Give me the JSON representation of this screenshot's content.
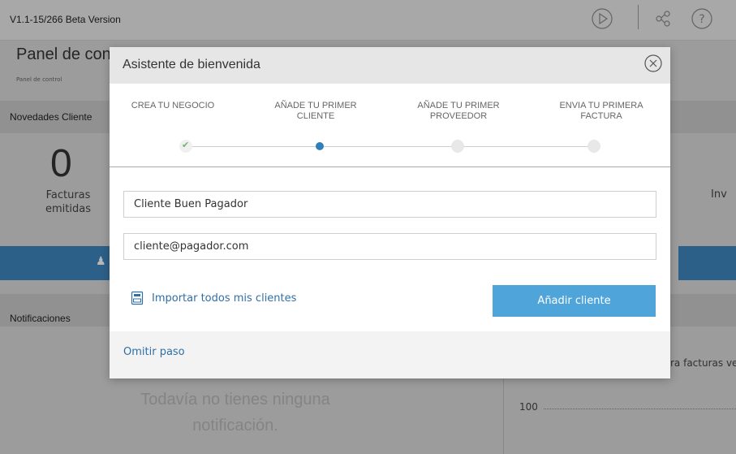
{
  "app": {
    "version": "V1.1-15/266 Beta Version",
    "panel_title": "Panel de control",
    "panel_breadcrumb": "Panel de control"
  },
  "background": {
    "news_label": "Novedades Cliente",
    "stat_value": "0",
    "stat_label": "Facturas emitidas",
    "stat_right_label": "Inv",
    "notifications_label": "Notificaciones",
    "empty_notifications": "Todavía no tienes ninguna notificación.",
    "chart_caption": "ra facturas ve",
    "chart_y_tick": "100"
  },
  "modal": {
    "title": "Asistente de bienvenida",
    "steps": [
      {
        "label": "CREA TU NEGOCIO",
        "state": "done"
      },
      {
        "label": "AÑADE TU PRIMER CLIENTE",
        "state": "active"
      },
      {
        "label": "AÑADE TU PRIMER PROVEEDOR",
        "state": "pending"
      },
      {
        "label": "ENVIA TU PRIMERA FACTURA",
        "state": "pending"
      }
    ],
    "client_name_value": "Cliente Buen Pagador",
    "client_email_value": "cliente@pagador.com",
    "import_label": "Importar todos mis clientes",
    "add_button_label": "Añadir cliente",
    "skip_label": "Omitir paso"
  },
  "colors": {
    "primary": "#4fa4d9",
    "active_step": "#2f7fb8",
    "link": "#2f6fa6",
    "done_check": "#71b56b"
  },
  "icons": [
    "play-icon",
    "share-icon",
    "help-icon",
    "close-icon",
    "check-icon",
    "import-file-icon",
    "user-icon"
  ]
}
